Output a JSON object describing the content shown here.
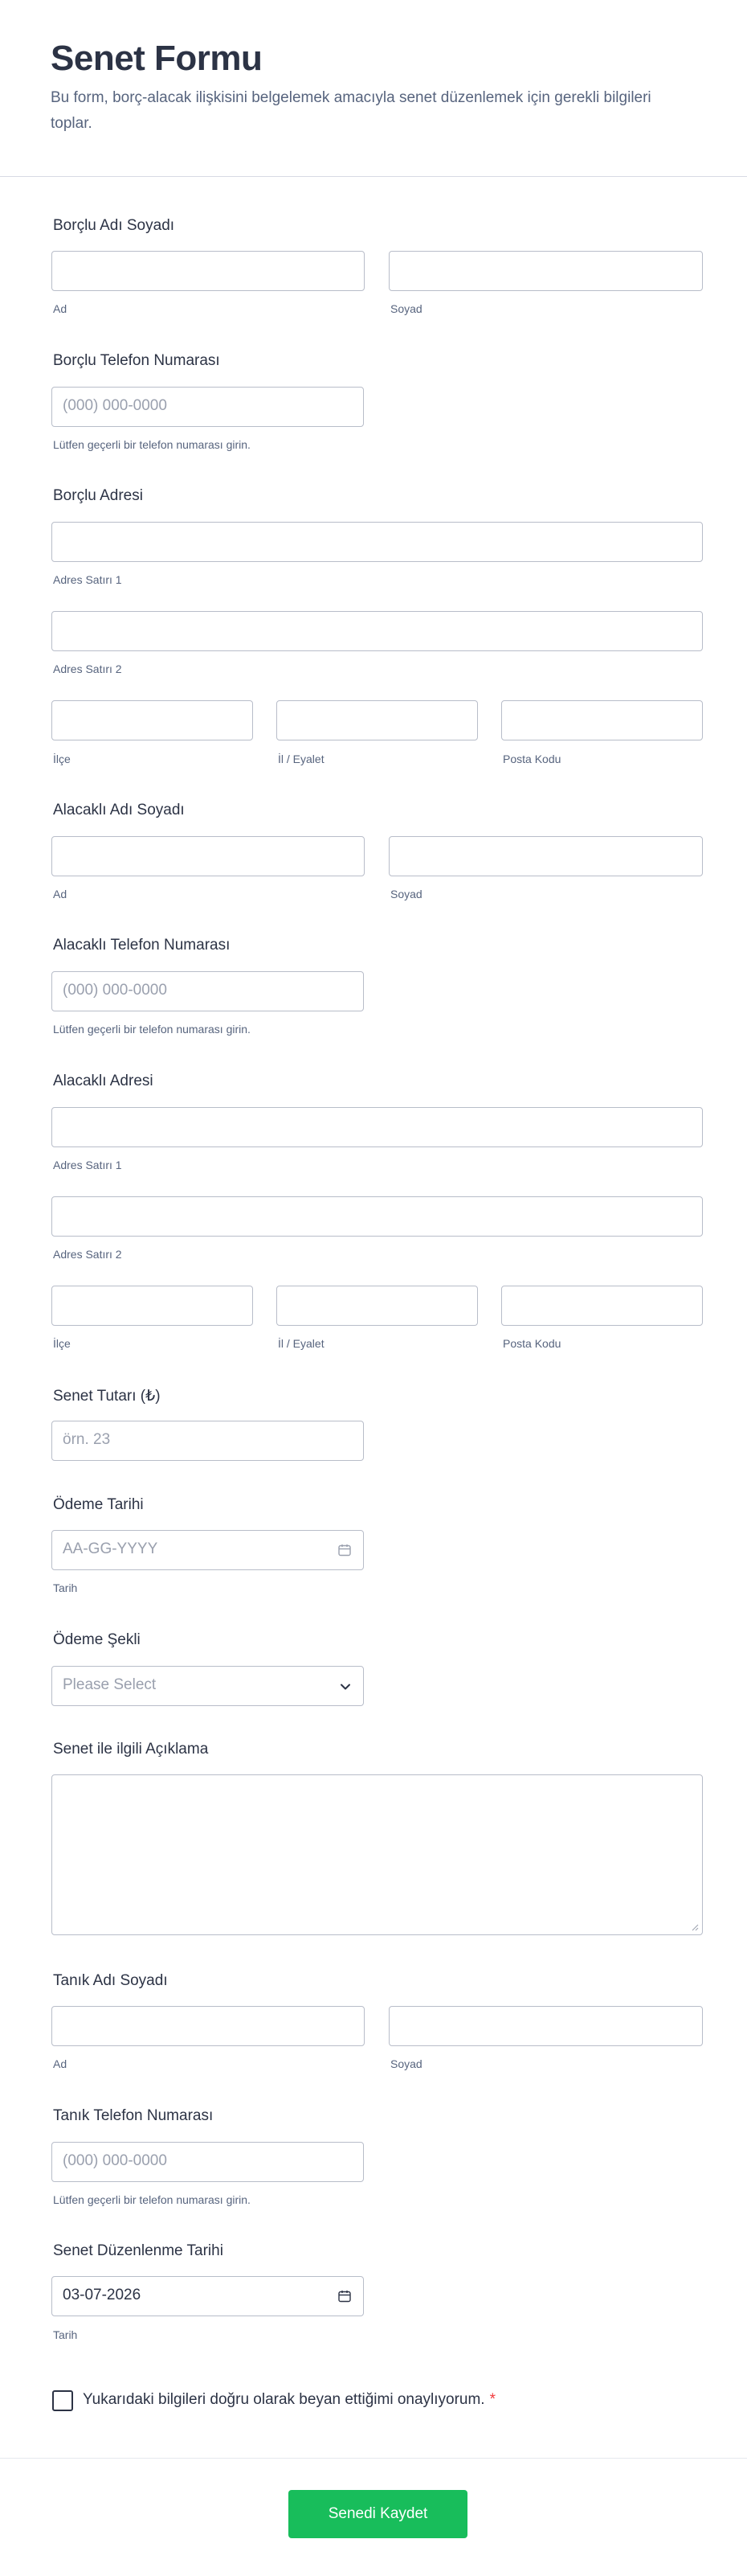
{
  "header": {
    "title": "Senet Formu",
    "subtitle": "Bu form, borç-alacak ilişkisini belgelemek amacıyla senet düzenlemek için gerekli bilgileri toplar."
  },
  "sublabels": {
    "first": "Ad",
    "last": "Soyad",
    "phone_hint": "Lütfen geçerli bir telefon numarası girin.",
    "addr1": "Adres Satırı 1",
    "addr2": "Adres Satırı 2",
    "district": "İlçe",
    "province": "İl / Eyalet",
    "postal": "Posta Kodu",
    "date": "Tarih"
  },
  "placeholders": {
    "phone": "(000) 000-0000",
    "amount": "örn. 23",
    "date": "AA-GG-YYYY",
    "select": "Please Select"
  },
  "fields": {
    "borrower_name": "Borçlu Adı Soyadı",
    "borrower_phone": "Borçlu Telefon Numarası",
    "borrower_address": "Borçlu Adresi",
    "creditor_name": "Alacaklı Adı Soyadı",
    "creditor_phone": "Alacaklı Telefon Numarası",
    "creditor_address": "Alacaklı Adresi",
    "amount": "Senet Tutarı (₺)",
    "payment_date": "Ödeme Tarihi",
    "payment_method": "Ödeme Şekli",
    "description": "Senet ile ilgili Açıklama",
    "witness_name": "Tanık Adı Soyadı",
    "witness_phone": "Tanık Telefon Numarası",
    "issue_date": "Senet Düzenlenme Tarihi"
  },
  "issue_date_value": "03-07-2026",
  "confirm": {
    "label": "Yukarıdaki bilgileri doğru olarak beyan ettiğimi onaylıyorum.",
    "required_mark": "*"
  },
  "submit_label": "Senedi Kaydet",
  "colors": {
    "accent": "#18bd5b",
    "required": "#f23a3c",
    "text": "#2c3345",
    "muted": "#57647e",
    "border": "#b8bdc9"
  }
}
